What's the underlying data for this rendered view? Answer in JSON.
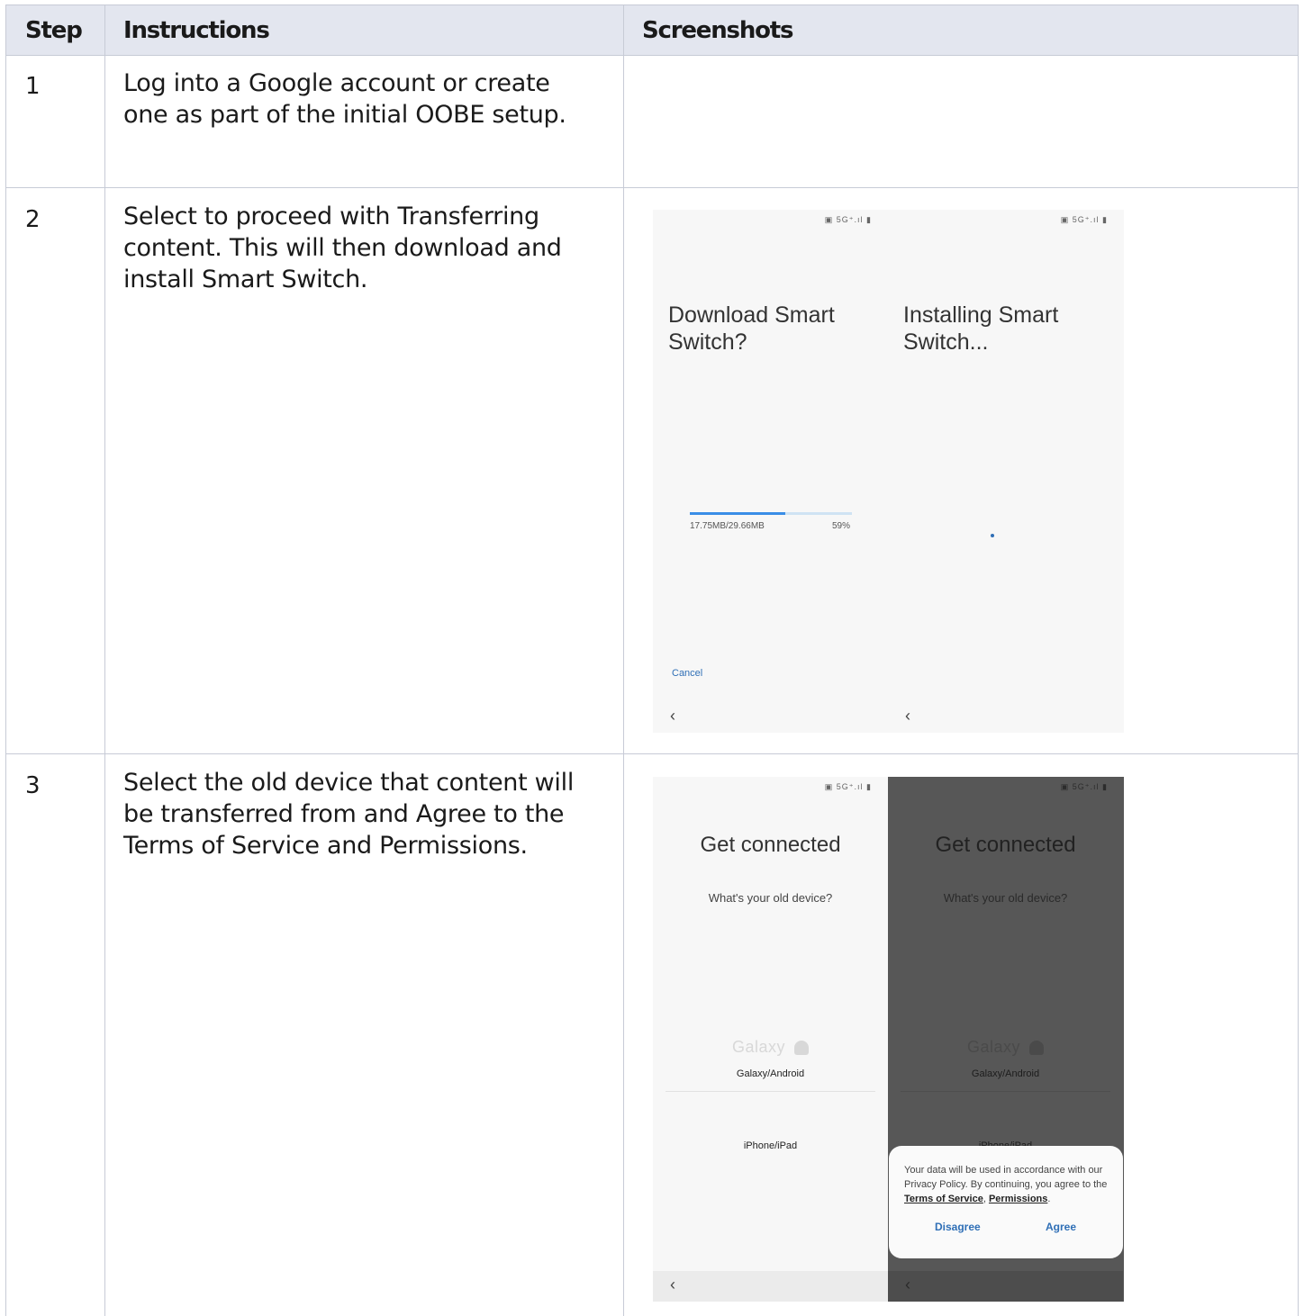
{
  "header": {
    "step": "Step",
    "instructions": "Instructions",
    "screenshots": "Screenshots"
  },
  "rows": [
    {
      "step": "1",
      "instructions": "Log into a Google account or create one as part of the initial OOBE setup."
    },
    {
      "step": "2",
      "instructions": "Select to proceed with Transferring content. This will then download and install Smart Switch.",
      "screens": {
        "download": {
          "status": "▣ 5G⁺.ıl ▮",
          "title": "Download Smart Switch?",
          "progress_text": "17.75MB/29.66MB",
          "progress_percent": "59%",
          "progress_fraction": 0.59,
          "cancel": "Cancel",
          "back": "‹"
        },
        "installing": {
          "status": "▣ 5G⁺.ıl ▮",
          "title": "Installing Smart Switch...",
          "back": "‹"
        }
      }
    },
    {
      "step": "3",
      "instructions": "Select the old device that content will be transferred from and Agree to the Terms of Service and Permissions.",
      "screens": {
        "select": {
          "status": "▣ 5G⁺.ıl ▮",
          "title": "Get connected",
          "subtitle": "What's your old device?",
          "galaxy_logo": "Galaxy",
          "option1": "Galaxy/Android",
          "option2": "iPhone/iPad",
          "apple_glyph": "",
          "back": "‹"
        },
        "agree": {
          "status": "▣ 5G⁺.ıl ▮",
          "title": "Get connected",
          "subtitle": "What's your old device?",
          "galaxy_logo": "Galaxy",
          "option1": "Galaxy/Android",
          "option2": "iPhone/iPad",
          "apple_glyph": "",
          "dialog_text_1": "Your data will be used in accordance with our Privacy Policy. By continuing, you agree to the ",
          "terms_link": "Terms of Service",
          "comma": ", ",
          "permissions_link": "Permissions",
          "period": ".",
          "disagree": "Disagree",
          "agree": "Agree",
          "back": "‹"
        }
      }
    }
  ],
  "colors": {
    "header_bg": "#e3e6ef",
    "grid_line": "#c7cbd6",
    "link_blue": "#2f6fb6",
    "progress_blue": "#3a8ee6",
    "dim_overlay": "#575757"
  }
}
